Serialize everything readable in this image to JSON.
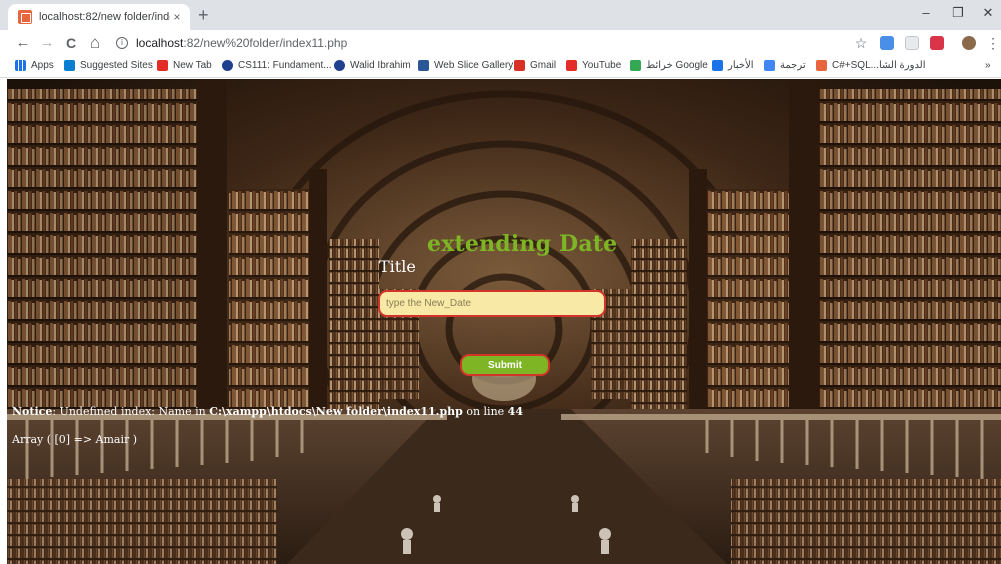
{
  "browser": {
    "tab": {
      "title": "localhost:82/new folder/index11.",
      "close": "×"
    },
    "new_tab": "+",
    "window_controls": {
      "minimize": "–",
      "restore": "❐",
      "close": "✕"
    },
    "nav": {
      "back": "←",
      "forward": "→",
      "reload": "C",
      "home": "⌂"
    },
    "url": {
      "host": "localhost",
      "path": ":82/new%20folder/index11.php"
    },
    "star": "☆",
    "menu": "⋮"
  },
  "bookmarks": [
    {
      "label": "Apps",
      "icon": "apps-grid-icon",
      "color": "#1a73e8"
    },
    {
      "label": "Suggested Sites",
      "icon": "bing-icon",
      "color": "#0a7fd1"
    },
    {
      "label": "New Tab",
      "icon": "youtube-icon",
      "color": "#e52d27"
    },
    {
      "label": "CS111: Fundament...",
      "icon": "cd-icon",
      "color": "#1f3f8f"
    },
    {
      "label": "Walid Ibrahim",
      "icon": "cd-icon",
      "color": "#1f3f8f"
    },
    {
      "label": "Web Slice Gallery",
      "icon": "web-slice-icon",
      "color": "#2b5797"
    },
    {
      "label": "Gmail",
      "icon": "gmail-icon",
      "color": "#d93025"
    },
    {
      "label": "YouTube",
      "icon": "youtube-icon",
      "color": "#e52d27"
    },
    {
      "label": "خرائط Google",
      "icon": "maps-icon",
      "color": "#34a853"
    },
    {
      "label": "الأخبار",
      "icon": "news-icon",
      "color": "#1a73e8"
    },
    {
      "label": "ترجمة",
      "icon": "translate-icon",
      "color": "#4285f4"
    },
    {
      "label": "C#+SQL...الدورة الشا",
      "icon": "course-icon",
      "color": "#e8663d"
    }
  ],
  "bookmarks_more": "»",
  "page": {
    "heading": "extending Date",
    "title_label": "Title",
    "input_placeholder": "type the New_Date",
    "submit_label": "Submit",
    "notice_label": "Notice",
    "notice_text": ": Undefined index: Name in ",
    "notice_path": "C:\\xampp\\htdocs\\New folder\\index11.php",
    "notice_online": " on line ",
    "notice_line": "44",
    "array_output": "Array ( [0] => Amair )"
  },
  "colors": {
    "heading": "#7db524",
    "input_bg": "#f8e9a6",
    "border_red": "#d2342a",
    "button_green": "#7db524"
  }
}
